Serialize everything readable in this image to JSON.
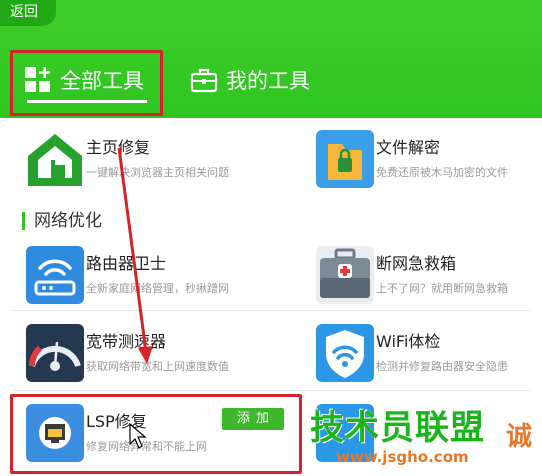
{
  "header": {
    "back_label": "返回",
    "tabs": [
      {
        "label": "全部工具",
        "active": true
      },
      {
        "label": "我的工具",
        "active": false
      }
    ]
  },
  "tools": {
    "home_repair": {
      "title": "主页修复",
      "desc": "一键解决浏览器主页相关问题"
    },
    "file_decrypt": {
      "title": "文件解密",
      "desc": "免费还原被木马加密的文件"
    }
  },
  "section": {
    "title": "网络优化"
  },
  "network_tools": {
    "router_guard": {
      "title": "路由器卫士",
      "desc": "全新家庭网络管理，秒揪蹭网"
    },
    "disconnect_rescue": {
      "title": "断网急救箱",
      "desc": "上不了网？就用断网急救箱"
    },
    "speed_test": {
      "title": "宽带测速器",
      "desc": "获取网络带宽和上网速度数值"
    },
    "wifi_check": {
      "title": "WiFi体检",
      "desc": "检测并修复路由器安全隐患"
    },
    "lsp_repair": {
      "title": "LSP修复",
      "desc": "修复网络异常和不能上网",
      "button_label": "添加"
    }
  },
  "watermark": {
    "main": "技术员联盟",
    "url": "www.jsgho.com",
    "extra": "诚"
  },
  "colors": {
    "header_green": "#2fc41f",
    "accent_green": "#3cb82a",
    "highlight_red": "#d4232a"
  }
}
